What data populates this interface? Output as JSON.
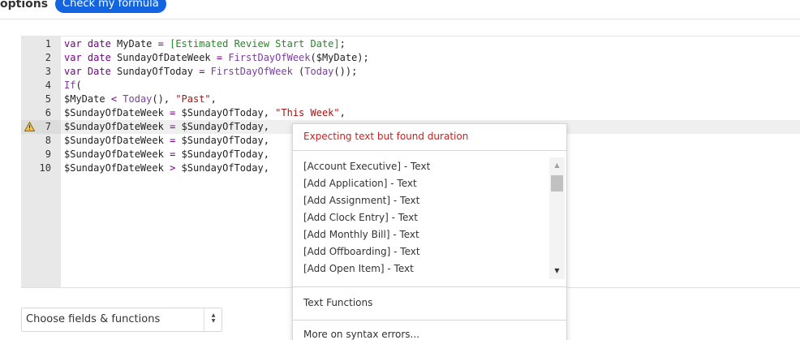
{
  "header": {
    "options_label": "options",
    "check_button": "Check my formula"
  },
  "editor": {
    "line_numbers": [
      "1",
      "2",
      "3",
      "4",
      "5",
      "6",
      "7",
      "8",
      "9",
      "10"
    ],
    "warning_line": 7,
    "lines": [
      {
        "tokens": [
          {
            "t": "kw",
            "v": "var"
          },
          {
            "t": "pl",
            "v": " "
          },
          {
            "t": "kw",
            "v": "date"
          },
          {
            "t": "pl",
            "v": " MyDate "
          },
          {
            "t": "op",
            "v": "="
          },
          {
            "t": "pl",
            "v": " "
          },
          {
            "t": "fld",
            "v": "[Estimated Review Start Date]"
          },
          {
            "t": "pl",
            "v": ";"
          }
        ]
      },
      {
        "tokens": [
          {
            "t": "kw",
            "v": "var"
          },
          {
            "t": "pl",
            "v": " "
          },
          {
            "t": "kw",
            "v": "date"
          },
          {
            "t": "pl",
            "v": " SundayOfDateWeek "
          },
          {
            "t": "op",
            "v": "="
          },
          {
            "t": "pl",
            "v": " "
          },
          {
            "t": "fn",
            "v": "FirstDayOfWeek"
          },
          {
            "t": "pl",
            "v": "($MyDate);"
          }
        ]
      },
      {
        "tokens": [
          {
            "t": "kw",
            "v": "var"
          },
          {
            "t": "pl",
            "v": " "
          },
          {
            "t": "kw",
            "v": "Date"
          },
          {
            "t": "pl",
            "v": " SundayOfToday "
          },
          {
            "t": "op",
            "v": "="
          },
          {
            "t": "pl",
            "v": " "
          },
          {
            "t": "fn",
            "v": "FirstDayOfWeek"
          },
          {
            "t": "pl",
            "v": " ("
          },
          {
            "t": "fn",
            "v": "Today"
          },
          {
            "t": "pl",
            "v": "());"
          }
        ]
      },
      {
        "tokens": [
          {
            "t": "fn",
            "v": "If"
          },
          {
            "t": "pl",
            "v": "("
          }
        ]
      },
      {
        "tokens": [
          {
            "t": "var",
            "v": "$MyDate"
          },
          {
            "t": "pl",
            "v": " "
          },
          {
            "t": "op",
            "v": "<"
          },
          {
            "t": "pl",
            "v": " "
          },
          {
            "t": "fn",
            "v": "Today"
          },
          {
            "t": "pl",
            "v": "(), "
          },
          {
            "t": "str",
            "v": "\"Past\""
          },
          {
            "t": "pl",
            "v": ","
          }
        ]
      },
      {
        "tokens": [
          {
            "t": "var",
            "v": "$SundayOfDateWeek"
          },
          {
            "t": "pl",
            "v": " "
          },
          {
            "t": "op",
            "v": "="
          },
          {
            "t": "pl",
            "v": " "
          },
          {
            "t": "var",
            "v": "$SundayOfToday"
          },
          {
            "t": "pl",
            "v": ", "
          },
          {
            "t": "str",
            "v": "\"This Week\""
          },
          {
            "t": "pl",
            "v": ","
          }
        ]
      },
      {
        "tokens": [
          {
            "t": "var",
            "v": "$SundayOfDateWeek"
          },
          {
            "t": "pl",
            "v": " "
          },
          {
            "t": "op",
            "v": "="
          },
          {
            "t": "pl",
            "v": " "
          },
          {
            "t": "var",
            "v": "$SundayOfToday"
          },
          {
            "t": "pl",
            "v": ", "
          }
        ]
      },
      {
        "tokens": [
          {
            "t": "var",
            "v": "$SundayOfDateWeek"
          },
          {
            "t": "pl",
            "v": " "
          },
          {
            "t": "op",
            "v": "="
          },
          {
            "t": "pl",
            "v": " "
          },
          {
            "t": "var",
            "v": "$SundayOfToday"
          },
          {
            "t": "pl",
            "v": ","
          }
        ]
      },
      {
        "tokens": [
          {
            "t": "var",
            "v": "$SundayOfDateWeek"
          },
          {
            "t": "pl",
            "v": " "
          },
          {
            "t": "op",
            "v": "="
          },
          {
            "t": "pl",
            "v": " "
          },
          {
            "t": "var",
            "v": "$SundayOfToday"
          },
          {
            "t": "pl",
            "v": ","
          }
        ]
      },
      {
        "tokens": [
          {
            "t": "var",
            "v": "$SundayOfDateWeek"
          },
          {
            "t": "pl",
            "v": " "
          },
          {
            "t": "op",
            "v": ">"
          },
          {
            "t": "pl",
            "v": " "
          },
          {
            "t": "var",
            "v": "$SundayOfToday"
          },
          {
            "t": "pl",
            "v": ","
          }
        ]
      }
    ]
  },
  "popup": {
    "error_message": "Expecting text but found duration",
    "items": [
      "[Account Executive] - Text",
      "[Add Application] - Text",
      "[Add Assignment] - Text",
      "[Add Clock Entry] - Text",
      "[Add Monthly Bill] - Text",
      "[Add Offboarding] - Text",
      "[Add Open Item] - Text"
    ],
    "text_functions_label": "Text Functions",
    "more_errors_label": "More on syntax errors..."
  },
  "chooser": {
    "label": "Choose fields & functions"
  },
  "colors": {
    "accent": "#1264e0",
    "error": "#d61c1c",
    "keyword": "#770088",
    "field": "#228b22",
    "string": "#a31515"
  },
  "icons": {
    "warning": "warning-triangle-icon",
    "select_arrows": "sort-arrows-icon"
  }
}
